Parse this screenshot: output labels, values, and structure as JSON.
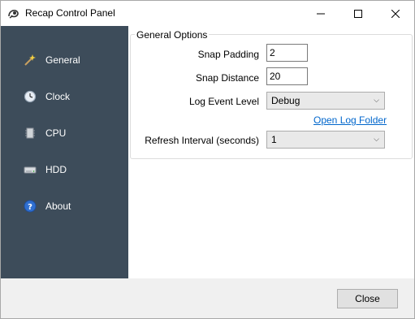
{
  "window": {
    "title": "Recap Control Panel",
    "icon": "recap-app-icon",
    "controls": {
      "minimize": "minimize-icon",
      "maximize": "maximize-icon",
      "close": "close-icon"
    }
  },
  "sidebar": {
    "background": "#3d4c5a",
    "items": [
      {
        "label": "General",
        "icon": "magic-wand-icon"
      },
      {
        "label": "Clock",
        "icon": "clock-icon"
      },
      {
        "label": "CPU",
        "icon": "cpu-icon"
      },
      {
        "label": "HDD",
        "icon": "hdd-icon"
      },
      {
        "label": "About",
        "icon": "help-icon"
      }
    ]
  },
  "general": {
    "group_title": "General Options",
    "snap_padding": {
      "label": "Snap Padding",
      "value": "2"
    },
    "snap_distance": {
      "label": "Snap Distance",
      "value": "20"
    },
    "log_event_level": {
      "label": "Log Event Level",
      "selected": "Debug"
    },
    "open_log_folder": "Open Log Folder",
    "refresh_interval": {
      "label": "Refresh Interval (seconds)",
      "selected": "1"
    }
  },
  "footer": {
    "close_label": "Close"
  }
}
